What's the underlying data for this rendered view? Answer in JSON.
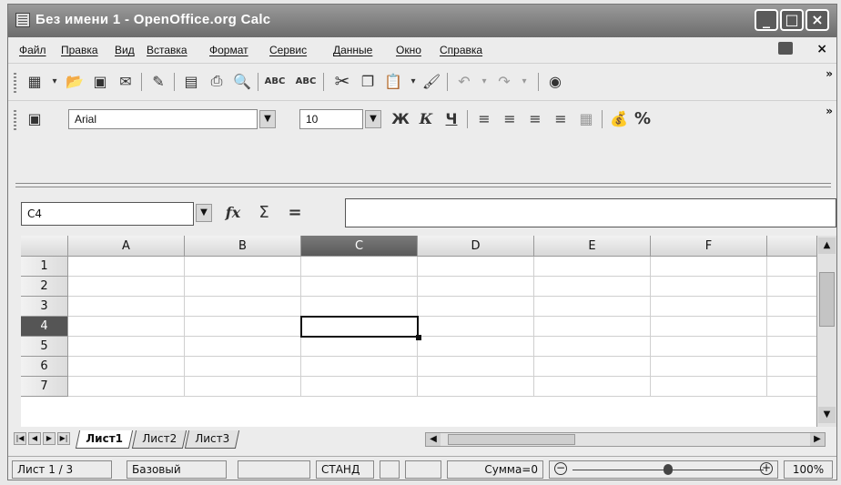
{
  "window": {
    "title": "Без имени 1 - OpenOffice.org Calc"
  },
  "menu": [
    "Файл",
    "Правка",
    "Вид",
    "Вставка",
    "Формат",
    "Сервис",
    "Данные",
    "Окно",
    "Справка"
  ],
  "formatting": {
    "font_name": "Arial",
    "font_size": "10",
    "bold": "Ж",
    "italic": "К",
    "underline": "Ч",
    "percent": "%"
  },
  "formula_bar": {
    "cell_ref": "C4",
    "fx": "fx",
    "sum": "Σ",
    "equals": "="
  },
  "grid": {
    "columns": [
      "A",
      "B",
      "C",
      "D",
      "E",
      "F"
    ],
    "rows": [
      "1",
      "2",
      "3",
      "4",
      "5",
      "6",
      "7"
    ],
    "active_cell": "C4"
  },
  "sheets": [
    "Лист1",
    "Лист2",
    "Лист3"
  ],
  "status": {
    "sheet": "Лист 1 / 3",
    "style": "Базовый",
    "mode": "СТАНД",
    "sum": "Сумма=0",
    "zoom": "100%"
  },
  "colors": {
    "titlebar": "#6c6c6c",
    "selected_header": "#5a5a5a"
  }
}
